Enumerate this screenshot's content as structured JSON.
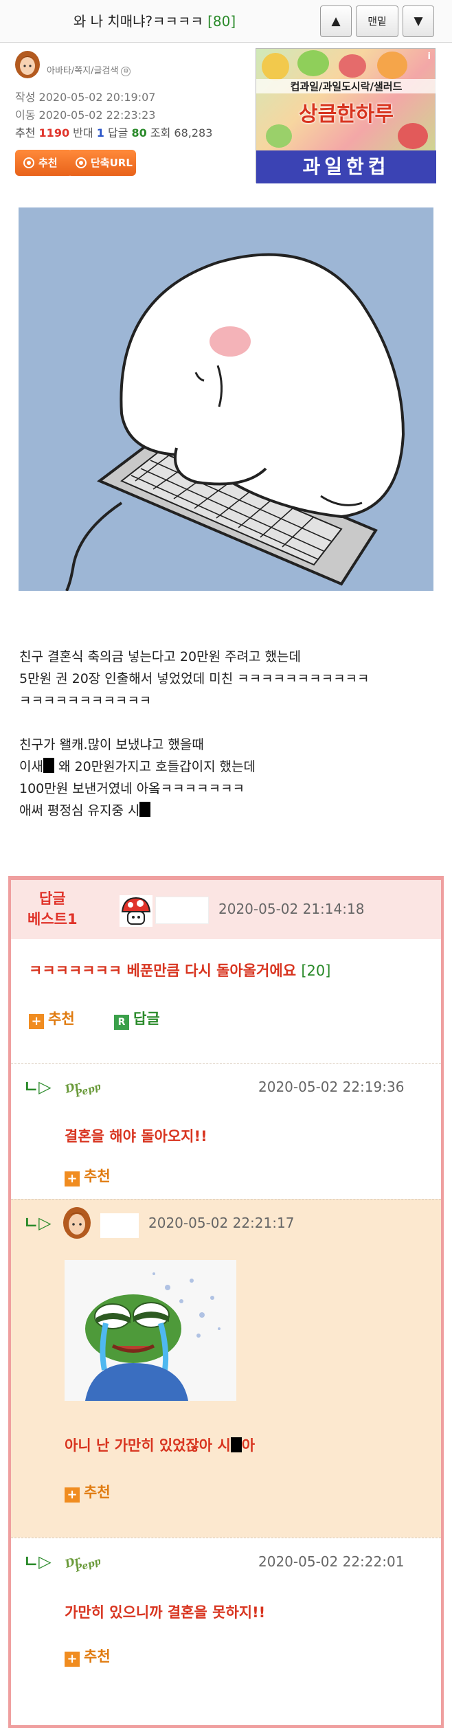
{
  "header": {
    "title": "와 나 치매냐?ㅋㅋㅋㅋ",
    "reply_count": "[80]",
    "up_label": "▲",
    "menu_label": "맨밑",
    "down_label": "▼"
  },
  "post": {
    "author_links": "아바타/쪽지/글검색",
    "written": "작성 2020-05-02 20:19:07",
    "moved": "이동 2020-05-02 22:23:23",
    "stats": {
      "recommend_label": "추천",
      "recommend": "1190",
      "oppose_label": "반대",
      "oppose": "1",
      "replies_label": "답글",
      "replies": "80",
      "views_label": "조회",
      "views": "68,283"
    },
    "buttons": {
      "recommend": "추천",
      "short_url": "단축URL"
    },
    "lines": [
      "친구 결혼식 축의금 넣는다고 20만원 주려고 했는데",
      "5만원 권 20장 인출해서 넣었었데 미친 ㅋㅋㅋㅋㅋㅋㅋㅋㅋㅋㅋ",
      "ㅋㅋㅋㅋㅋㅋㅋㅋㅋㅋㅋ",
      "",
      "친구가 왤캐.많이 보냈냐고 했을때",
      "이새",
      " 왜 20만원가지고 호들갑이지 했는데",
      "100만원 보낸거였네 아옼ㅋㅋㅋㅋㅋㅋㅋ",
      "애써 평정심 유지중 시"
    ]
  },
  "ad": {
    "sub": "컵과일/과일도시락/샐러드",
    "main": "상큼한하루",
    "banner": "과일한컵",
    "info": "i"
  },
  "comments": {
    "best_label_1": "답글",
    "best_label_2": "베스트1",
    "best": {
      "date": "2020-05-02 21:14:18",
      "text": "ㅋㅋㅋㅋㅋㅋㅋ 베푼만큼 다시 돌아올거에요",
      "count": "[20]",
      "recommend": "추천",
      "reply": "답글"
    },
    "replies": [
      {
        "date": "2020-05-02 22:19:36",
        "text": "결혼을 해야 돌아오지!!",
        "recommend": "추천"
      },
      {
        "date": "2020-05-02 22:21:17",
        "text_a": "아니 난 가만히 있었잖아 시",
        "text_b": "아",
        "recommend": "추천"
      },
      {
        "date": "2020-05-02 22:22:01",
        "text": "가만히 있으니까 결혼을 못하지!!",
        "recommend": "추천"
      }
    ],
    "reply_arrow": "ㄴ▷",
    "plus": "+",
    "r_badge": "R"
  },
  "colors": {
    "accent_red": "#d8341f",
    "reply_green": "#2a8a2a",
    "border_pink": "#ef9f9f",
    "button_orange": "#e8621a",
    "reply_tan": "#fce8cf"
  }
}
